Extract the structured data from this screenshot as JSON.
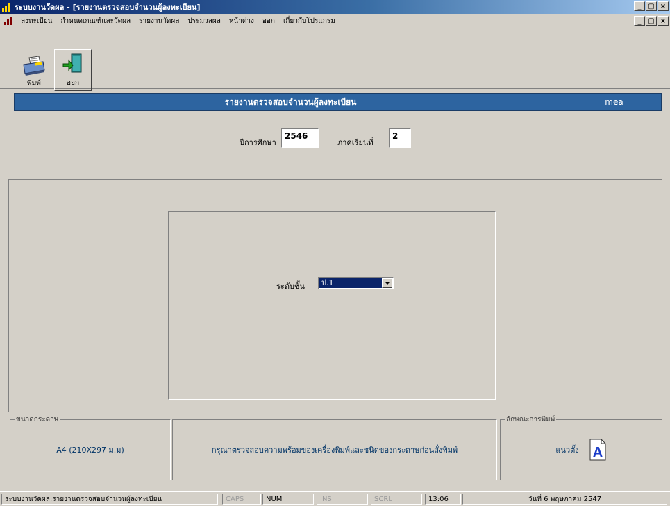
{
  "window": {
    "title": "ระบบงานวัดผล - [รายงานตรวจสอบจำนวนผู้ลงทะเบียน]",
    "controls": [
      "_",
      "▢",
      "×"
    ]
  },
  "menu": {
    "items": [
      "ลงทะเบียน",
      "กำหนดเกณฑ์และวัดผล",
      "รายงานวัดผล",
      "ประมวลผล",
      "หน้าต่าง",
      "ออก",
      "เกี่ยวกับโปรแกรม"
    ]
  },
  "toolbar": {
    "print_label": "พิมพ์",
    "exit_label": "ออก"
  },
  "header": {
    "title": "รายงานตรวจสอบจำนวนผู้ลงทะเบียน",
    "user": "mea"
  },
  "filters": {
    "year_label": "ปีการศึกษา",
    "year_value": "2546",
    "term_label": "ภาคเรียนที่",
    "term_value": "2"
  },
  "form": {
    "grade_label": "ระดับชั้น",
    "grade_value": "ป.1"
  },
  "paper": {
    "legend": "ขนาดกระดาษ",
    "value": "A4 (210X297 ม.ม)"
  },
  "notice": {
    "text": "กรุณาตรวจสอบความพร้อมของเครื่องพิมพ์และชนิดของกระดาษก่อนสั่งพิมพ์"
  },
  "orientation": {
    "legend": "ลักษณะการพิมพ์",
    "value": "แนวตั้ง",
    "icon_letter": "A"
  },
  "status": {
    "message": "ระบบงานวัดผล:รายงานตรวจสอบจำนวนผู้ลงทะเบียน",
    "caps": "CAPS",
    "num": "NUM",
    "ins": "INS",
    "scrl": "SCRL",
    "time": "13:06",
    "date": "วันที่ 6 พฤษภาคม 2547"
  },
  "colors": {
    "header_bar": "#2d64a0",
    "title_bar": "#0a246a",
    "selection": "#0a246a",
    "panel_bg": "#d4d0c8"
  }
}
